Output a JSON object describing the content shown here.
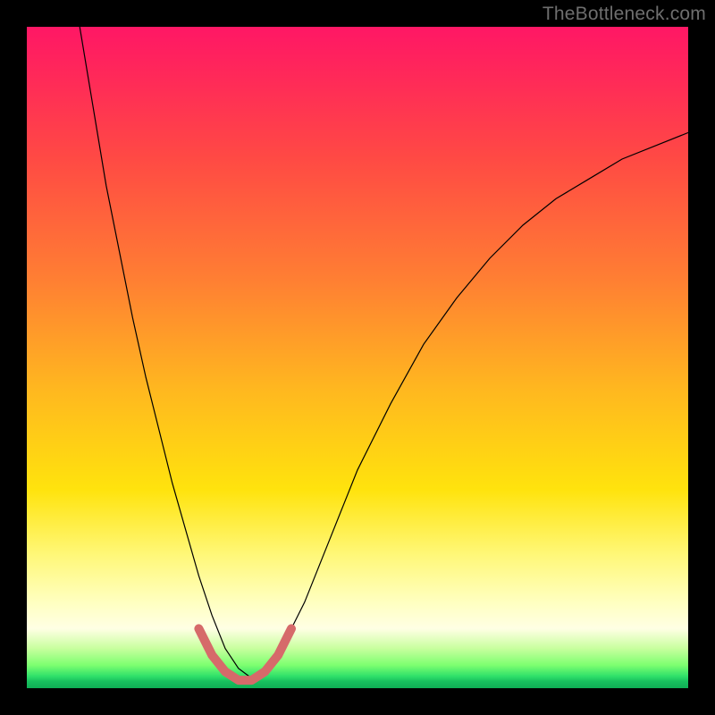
{
  "watermark": "TheBottleneck.com",
  "chart_data": {
    "type": "line",
    "title": "",
    "xlabel": "",
    "ylabel": "",
    "xlim": [
      0,
      100
    ],
    "ylim": [
      0,
      100
    ],
    "grid": false,
    "legend": false,
    "annotations": [],
    "series": [
      {
        "name": "curve",
        "color": "#000000",
        "stroke_width": 1.2,
        "x": [
          8,
          10,
          12,
          14,
          16,
          18,
          20,
          22,
          24,
          26,
          28,
          30,
          32,
          34,
          36,
          38,
          40,
          42,
          44,
          46,
          48,
          50,
          55,
          60,
          65,
          70,
          75,
          80,
          85,
          90,
          95,
          100
        ],
        "y": [
          100,
          88,
          76,
          66,
          56,
          47,
          39,
          31,
          24,
          17,
          11,
          6,
          3,
          1.5,
          2.5,
          5,
          9,
          13,
          18,
          23,
          28,
          33,
          43,
          52,
          59,
          65,
          70,
          74,
          77,
          80,
          82,
          84
        ]
      },
      {
        "name": "marker",
        "color": "#d66a6a",
        "stroke_width": 10,
        "linecap": "round",
        "x": [
          26,
          28,
          30,
          32,
          34,
          36,
          38,
          40
        ],
        "y": [
          9,
          5,
          2.5,
          1.2,
          1.2,
          2.5,
          5,
          9
        ]
      }
    ],
    "background": {
      "type": "vertical-gradient",
      "stops": [
        {
          "pos": 0.0,
          "color": "#ff1765"
        },
        {
          "pos": 0.08,
          "color": "#ff2a58"
        },
        {
          "pos": 0.2,
          "color": "#ff4a44"
        },
        {
          "pos": 0.38,
          "color": "#ff7e33"
        },
        {
          "pos": 0.55,
          "color": "#ffb81f"
        },
        {
          "pos": 0.7,
          "color": "#ffe30d"
        },
        {
          "pos": 0.8,
          "color": "#fff87a"
        },
        {
          "pos": 0.87,
          "color": "#ffffc0"
        },
        {
          "pos": 0.91,
          "color": "#ffffe4"
        },
        {
          "pos": 0.94,
          "color": "#c8ff9e"
        },
        {
          "pos": 0.965,
          "color": "#7eff70"
        },
        {
          "pos": 0.982,
          "color": "#2fe06a"
        },
        {
          "pos": 0.99,
          "color": "#17c05e"
        },
        {
          "pos": 1.0,
          "color": "#0fae55"
        }
      ]
    }
  }
}
